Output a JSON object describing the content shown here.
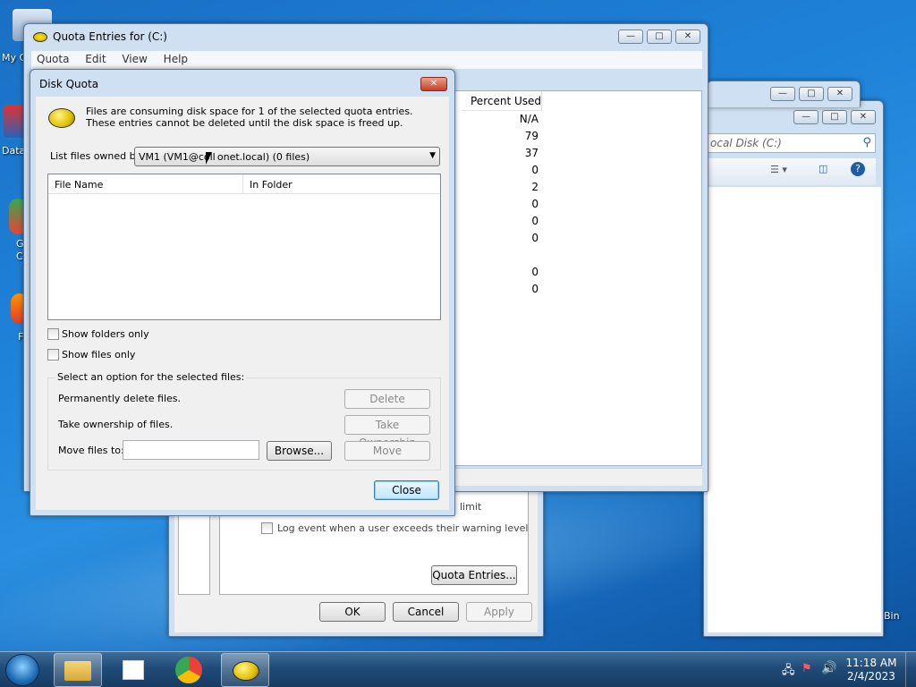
{
  "desktop": {
    "icons": [
      {
        "name": "computer",
        "label": "My C"
      },
      {
        "name": "data-app",
        "label": "Data"
      },
      {
        "name": "google-chrome",
        "label": "G\nC"
      },
      {
        "name": "firefox",
        "label": "F"
      },
      {
        "name": "recycle-bin",
        "label": "Bin"
      }
    ]
  },
  "quota_window": {
    "title": "Quota Entries for  (C:)",
    "menu": [
      "Quota",
      "Edit",
      "View",
      "Help"
    ],
    "column_header": "Percent Used",
    "percent_values": [
      "N/A",
      "79",
      "37",
      "0",
      "2",
      "0",
      "0",
      "0",
      "",
      "0",
      "0"
    ]
  },
  "explorer_window": {
    "address_text": "ocal Disk (C:)"
  },
  "properties_dialog": {
    "warning_text": "limit",
    "log_event_label": "Log event when a user exceeds their warning level",
    "quota_entries_button": "Quota Entries...",
    "ok": "OK",
    "cancel": "Cancel",
    "apply": "Apply"
  },
  "disk_quota_dialog": {
    "title": "Disk Quota",
    "message": "Files are consuming disk space for 1 of the selected quota entries.  These entries cannot be deleted until the disk space is freed up.",
    "list_owner_label": "List files owned by:",
    "owner_value": "VM1 (VM1@coll onet.local) (0 files)",
    "columns": [
      "File Name",
      "In Folder"
    ],
    "show_folders_only": "Show folders only",
    "show_files_only": "Show files only",
    "select_option_label": "Select an option for the selected files:",
    "permanently_delete": "Permanently delete files.",
    "delete_button": "Delete",
    "take_ownership_label": "Take ownership of files.",
    "take_ownership_button": "Take Ownership",
    "move_files_label": "Move files to:",
    "browse_button": "Browse...",
    "move_button": "Move",
    "close_button": "Close"
  },
  "taskbar": {
    "time": "11:18 AM",
    "date": "2/4/2023"
  }
}
